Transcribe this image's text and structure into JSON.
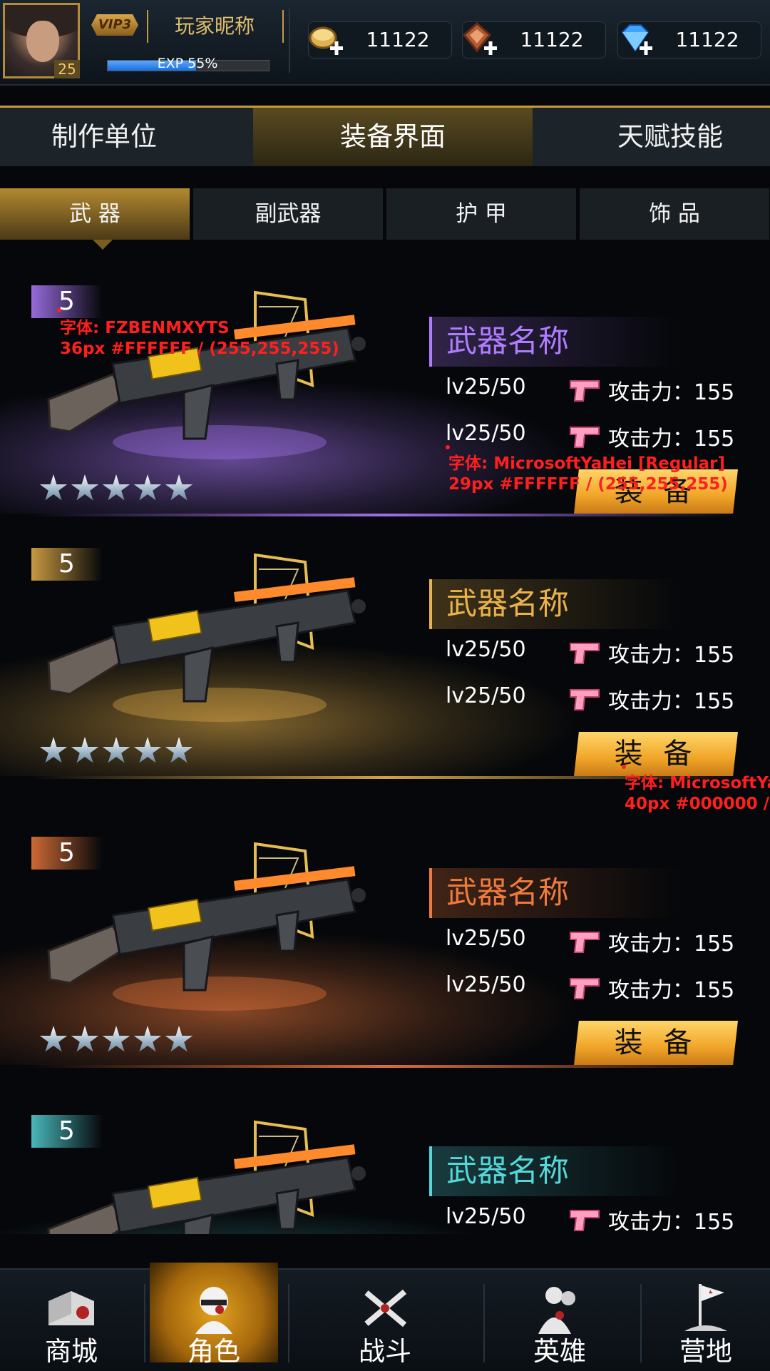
{
  "player": {
    "level": "25",
    "vip": "VIP3",
    "nickname": "玩家昵称",
    "exp_label": "EXP 55%",
    "exp_progress": 0.55
  },
  "currencies": [
    {
      "icon": "gold-coin-plus-icon",
      "value": "11122"
    },
    {
      "icon": "badge-plus-icon",
      "value": "11122"
    },
    {
      "icon": "diamond-plus-icon",
      "value": "11122"
    }
  ],
  "main_tabs": [
    {
      "label": "制作单位",
      "active": false
    },
    {
      "label": "装备界面",
      "active": true
    },
    {
      "label": "天赋技能",
      "active": false
    }
  ],
  "sub_tabs": [
    {
      "label": "武 器",
      "active": true
    },
    {
      "label": "副武器",
      "active": false
    },
    {
      "label": "护 甲",
      "active": false
    },
    {
      "label": "饰 品",
      "active": false
    }
  ],
  "weapons": [
    {
      "rarity": "5",
      "name": "武器名称",
      "color": "#b07cff",
      "stars": 5,
      "stats": [
        {
          "level": "lv25/50",
          "attack": "攻击力：155"
        },
        {
          "level": "lv25/50",
          "attack": "攻击力：155"
        }
      ],
      "equip_label": "装 备"
    },
    {
      "rarity": "5",
      "name": "武器名称",
      "color": "#e9b24a",
      "stars": 5,
      "stats": [
        {
          "level": "lv25/50",
          "attack": "攻击力：155"
        },
        {
          "level": "lv25/50",
          "attack": "攻击力：155"
        }
      ],
      "equip_label": "装 备"
    },
    {
      "rarity": "5",
      "name": "武器名称",
      "color": "#f07a3c",
      "stars": 5,
      "stats": [
        {
          "level": "lv25/50",
          "attack": "攻击力：155"
        },
        {
          "level": "lv25/50",
          "attack": "攻击力：155"
        }
      ],
      "equip_label": "装 备"
    },
    {
      "rarity": "5",
      "name": "武器名称",
      "color": "#55d6d8",
      "stars": 5,
      "stats": [
        {
          "level": "lv25/50",
          "attack": "攻击力：155"
        }
      ],
      "equip_label": ""
    }
  ],
  "annotations": [
    "字体: FZBENMXYTS\n36px #FFFFFF / (255,255,255)",
    "字体: MicrosoftYaHei [Regular]\n29px #FFFFFF / (255,255,255)",
    "字体: MicrosoftYa\n40px #000000 / ("
  ],
  "bottom_nav": [
    {
      "label": "商城",
      "icon": "shop-icon",
      "active": false
    },
    {
      "label": "角色",
      "icon": "character-icon",
      "active": true
    },
    {
      "label": "战斗",
      "icon": "battle-guns-icon",
      "active": false
    },
    {
      "label": "英雄",
      "icon": "hero-icon",
      "active": false
    },
    {
      "label": "营地",
      "icon": "camp-flag-icon",
      "active": false
    }
  ]
}
